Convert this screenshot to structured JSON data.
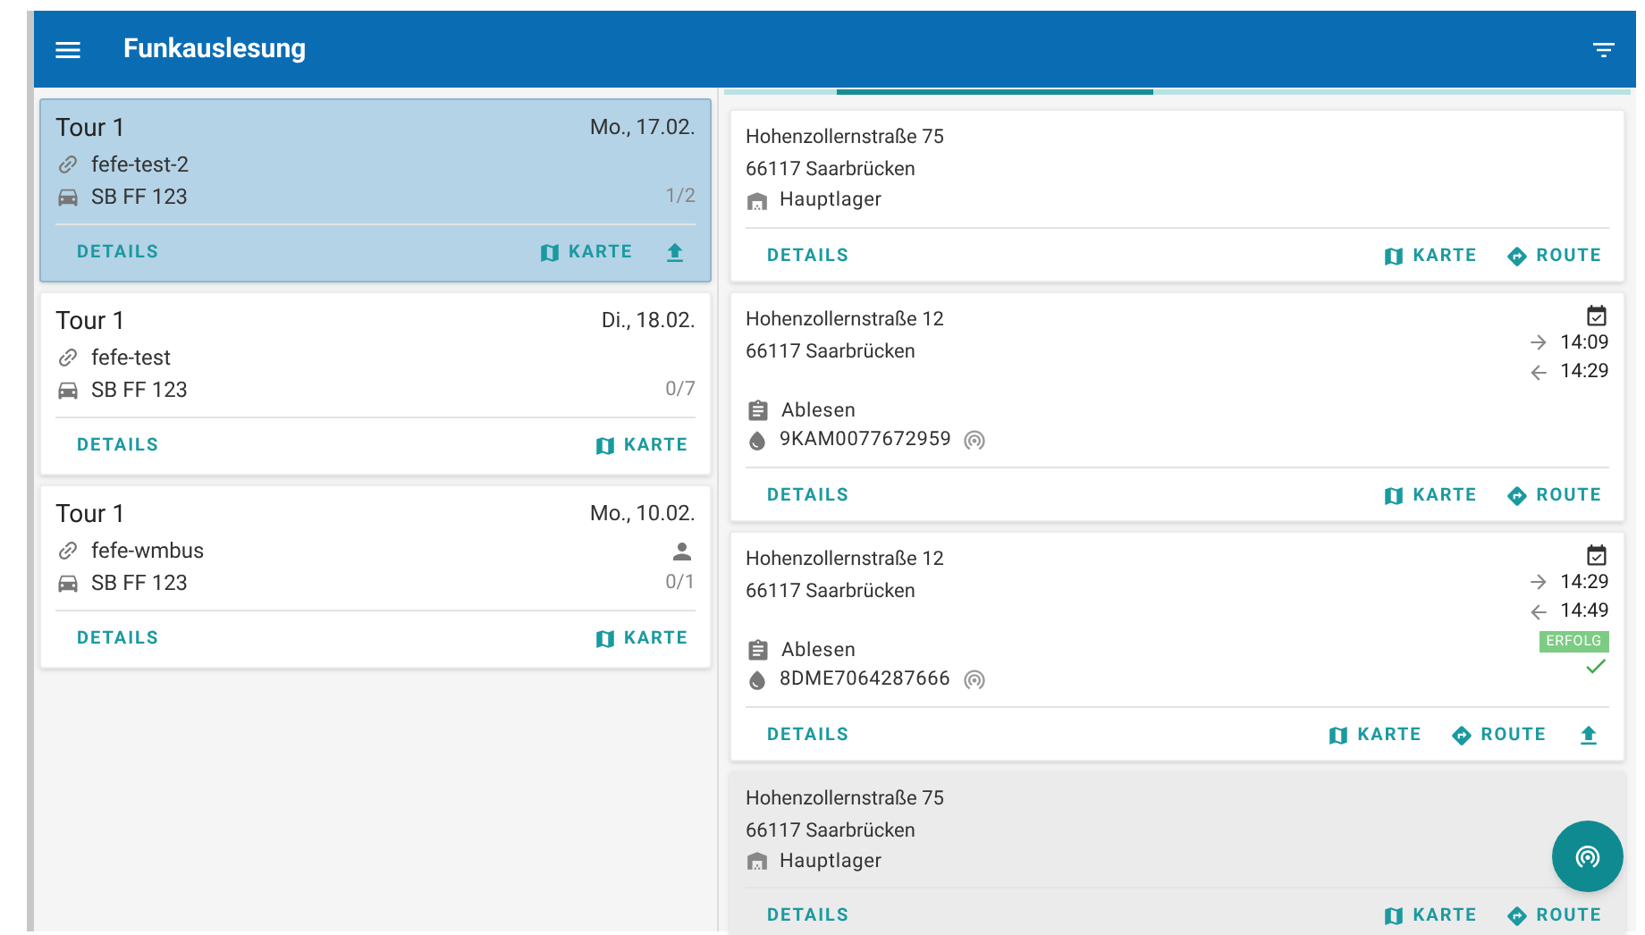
{
  "app_bar": {
    "title": "Funkauslesung"
  },
  "tours": [
    {
      "name": "Tour 1",
      "date": "Mo., 17.02.",
      "device": "fefe-test-2",
      "vehicle": "SB FF 123",
      "progress": "1/2",
      "selected": true,
      "assigned_person": false,
      "actions": [
        {
          "kind": "details",
          "label": "DETAILS"
        },
        {
          "kind": "map",
          "label": "KARTE"
        },
        {
          "kind": "upload"
        }
      ]
    },
    {
      "name": "Tour 1",
      "date": "Di., 18.02.",
      "device": "fefe-test",
      "vehicle": "SB FF 123",
      "progress": "0/7",
      "selected": false,
      "assigned_person": false,
      "actions": [
        {
          "kind": "details",
          "label": "DETAILS"
        },
        {
          "kind": "map",
          "label": "KARTE"
        }
      ]
    },
    {
      "name": "Tour 1",
      "date": "Mo., 10.02.",
      "device": "fefe-wmbus",
      "vehicle": "SB FF 123",
      "progress": "0/1",
      "selected": false,
      "assigned_person": true,
      "actions": [
        {
          "kind": "details",
          "label": "DETAILS"
        },
        {
          "kind": "map",
          "label": "KARTE"
        }
      ]
    }
  ],
  "stops": [
    {
      "kind": "depot",
      "street": "Hohenzollernstraße 75",
      "city": "66117 Saarbrücken",
      "place": "Hauptlager",
      "highlighted": false,
      "actions": [
        {
          "kind": "details",
          "label": "DETAILS"
        },
        {
          "kind": "map",
          "label": "KARTE"
        },
        {
          "kind": "route",
          "label": "ROUTE"
        }
      ]
    },
    {
      "kind": "reading",
      "street": "Hohenzollernstraße 12",
      "city": "66117 Saarbrücken",
      "arrival": "14:09",
      "departure": "14:29",
      "task": "Ablesen",
      "meter": "9KAM0077672959",
      "highlighted": false,
      "success": false,
      "actions": [
        {
          "kind": "details",
          "label": "DETAILS"
        },
        {
          "kind": "map",
          "label": "KARTE"
        },
        {
          "kind": "route",
          "label": "ROUTE"
        }
      ]
    },
    {
      "kind": "reading",
      "street": "Hohenzollernstraße 12",
      "city": "66117 Saarbrücken",
      "arrival": "14:29",
      "departure": "14:49",
      "task": "Ablesen",
      "meter": "8DME7064287666",
      "status": "ERFOLG",
      "highlighted": false,
      "success": true,
      "actions": [
        {
          "kind": "details",
          "label": "DETAILS"
        },
        {
          "kind": "map",
          "label": "KARTE"
        },
        {
          "kind": "route",
          "label": "ROUTE"
        },
        {
          "kind": "upload"
        }
      ]
    },
    {
      "kind": "depot",
      "street": "Hohenzollernstraße 75",
      "city": "66117 Saarbrücken",
      "place": "Hauptlager",
      "highlighted": true,
      "actions": [
        {
          "kind": "details",
          "label": "DETAILS"
        },
        {
          "kind": "map",
          "label": "KARTE"
        },
        {
          "kind": "route",
          "label": "ROUTE"
        }
      ]
    }
  ]
}
